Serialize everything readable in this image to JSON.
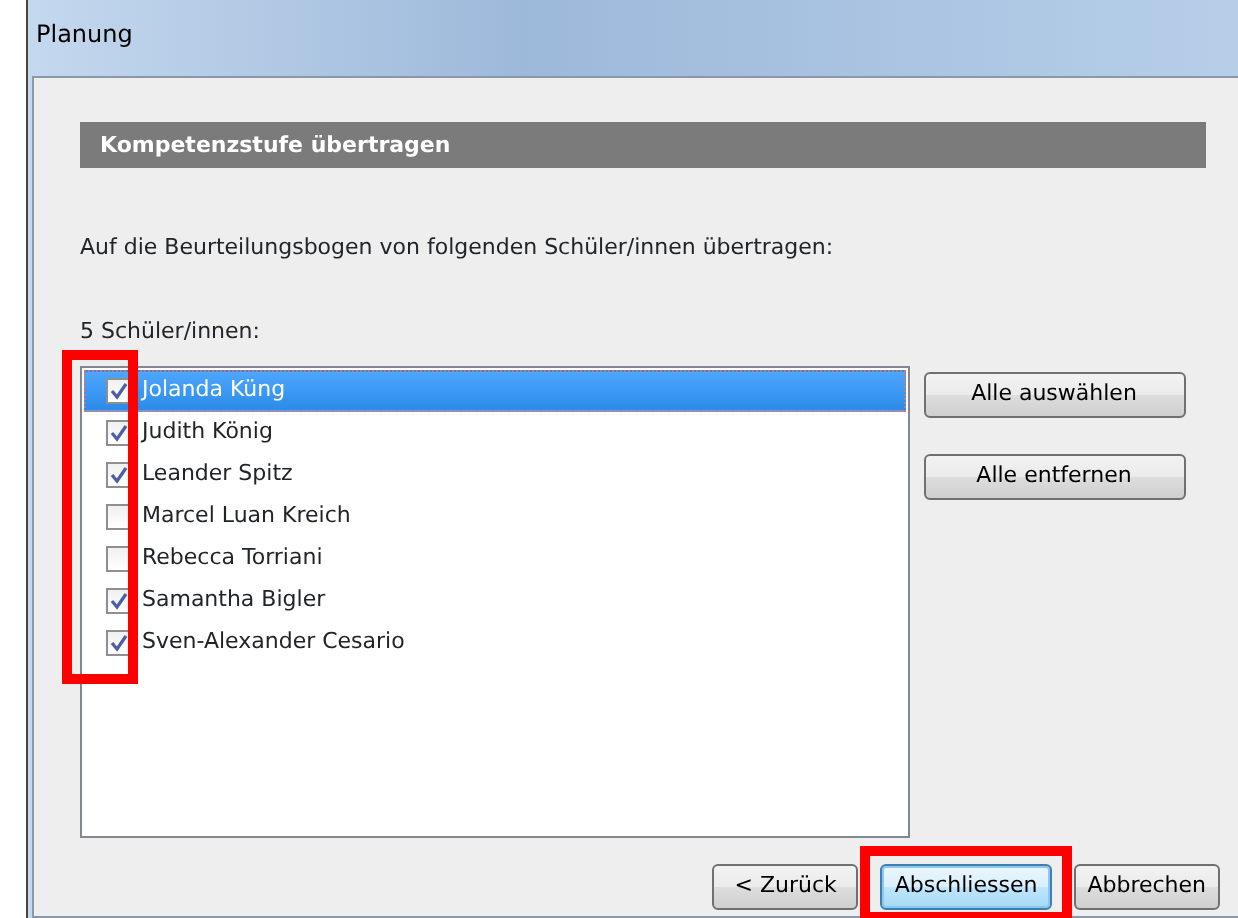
{
  "window": {
    "title": "Planung"
  },
  "section": {
    "title": "Kompetenzstufe übertragen"
  },
  "instruction": "Auf die Beurteilungsbogen von folgenden Schüler/innen übertragen:",
  "count_label": "5 Schüler/innen:",
  "checkbox_column_highlighted": true,
  "students": [
    {
      "name": "Jolanda Küng",
      "checked": true,
      "selected": true
    },
    {
      "name": "Judith König",
      "checked": true,
      "selected": false
    },
    {
      "name": "Leander Spitz",
      "checked": true,
      "selected": false
    },
    {
      "name": "Marcel Luan Kreich",
      "checked": false,
      "selected": false
    },
    {
      "name": "Rebecca Torriani",
      "checked": false,
      "selected": false
    },
    {
      "name": "Samantha Bigler",
      "checked": true,
      "selected": false
    },
    {
      "name": "Sven-Alexander Cesario",
      "checked": true,
      "selected": false
    }
  ],
  "side_buttons": [
    "Alle auswählen",
    "Alle entfernen"
  ],
  "footer_buttons": [
    {
      "label": "< Zurück",
      "focused": false,
      "highlighted": false
    },
    {
      "label": "Abschliessen",
      "focused": true,
      "highlighted": true
    },
    {
      "label": "Abbrechen",
      "focused": false,
      "highlighted": false
    }
  ]
}
